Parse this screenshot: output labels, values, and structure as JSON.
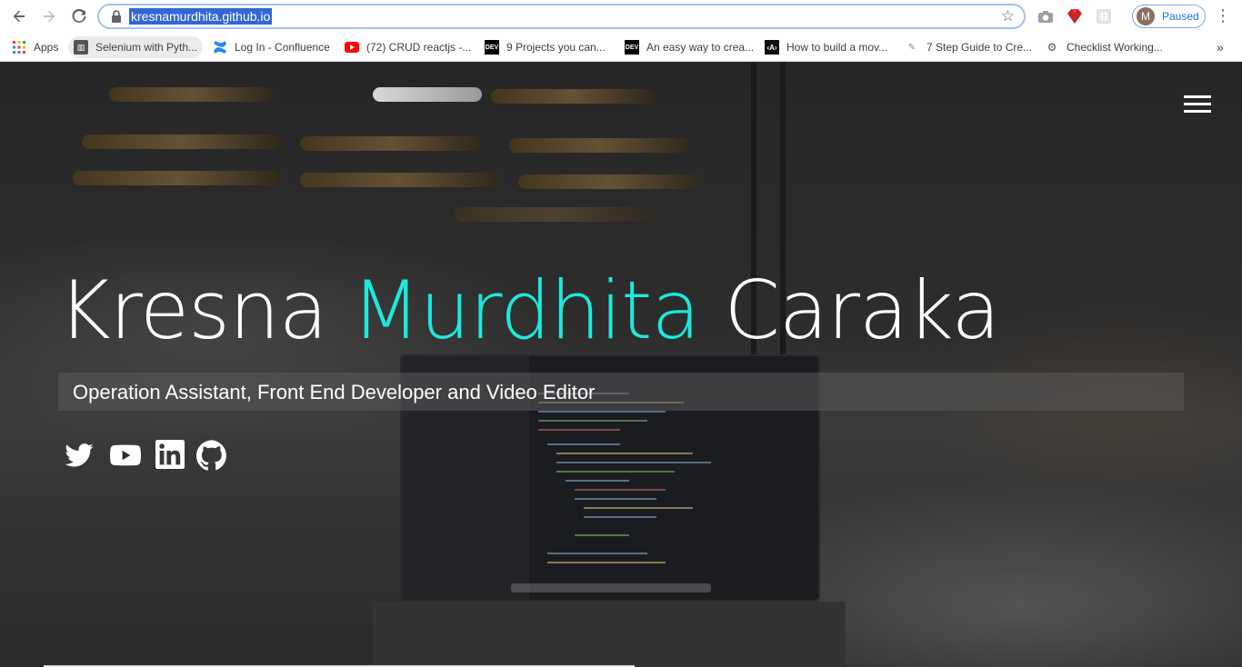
{
  "browser": {
    "url": "kresnamurdhita.github.io",
    "profile_initial": "M",
    "profile_status": "Paused"
  },
  "bookmarks": [
    {
      "label": "Apps"
    },
    {
      "label": "Selenium with Pyth..."
    },
    {
      "label": "Log In - Confluence"
    },
    {
      "label": "(72) CRUD reactjs -..."
    },
    {
      "label": "9 Projects you can..."
    },
    {
      "label": "An easy way to crea..."
    },
    {
      "label": "How to build a mov..."
    },
    {
      "label": "7 Step Guide to Cre..."
    },
    {
      "label": "Checklist Working..."
    }
  ],
  "bookmarks_overflow": "»",
  "hero": {
    "name_first": "Kresna ",
    "name_middle": "Murdhita",
    "name_last": " Caraka",
    "subtitle": "Operation Assistant, Front End Developer and Video Editor",
    "accent_color": "#1de9dc"
  },
  "social": [
    "twitter-icon",
    "youtube-icon",
    "linkedin-icon",
    "github-icon"
  ]
}
